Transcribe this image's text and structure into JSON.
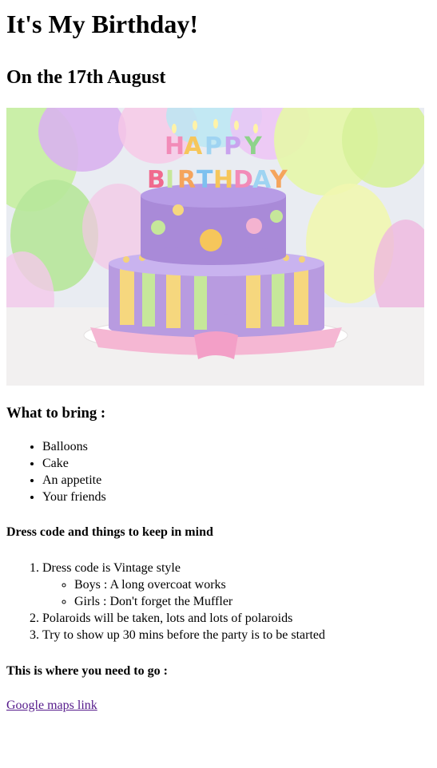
{
  "page": {
    "title": "It's My Birthday!",
    "subtitle": "On the 17th August"
  },
  "hero": {
    "cake_topper_text": "HAPPY BIRTHDAY"
  },
  "bring": {
    "heading": "What to bring :",
    "items": [
      "Balloons",
      "Cake",
      "An appetite",
      "Your friends"
    ]
  },
  "dress": {
    "heading": "Dress code and things to keep in mind",
    "items": [
      {
        "label": "Dress code is Vintage style",
        "sub": [
          "Boys : A long overcoat works",
          "Girls : Don't forget the Muffler"
        ]
      },
      {
        "label": "Polaroids will be taken, lots and lots of polaroids"
      },
      {
        "label": "Try to show up 30 mins before the party is to be started"
      }
    ]
  },
  "location": {
    "heading": "This is where you need to go :",
    "link_text": "Google maps link"
  },
  "colors": {
    "link_visited": "#551a8b"
  }
}
